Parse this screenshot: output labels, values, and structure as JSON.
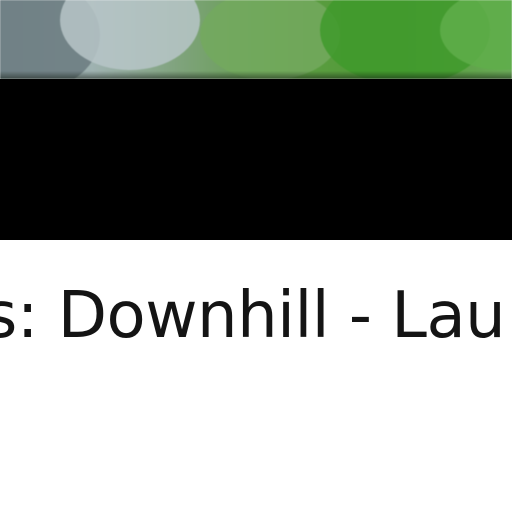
{
  "video": {
    "title_fragment": "s: Downhill - Lau"
  },
  "colors": {
    "band": "#000000",
    "background": "#ffffff",
    "text": "#141414"
  }
}
